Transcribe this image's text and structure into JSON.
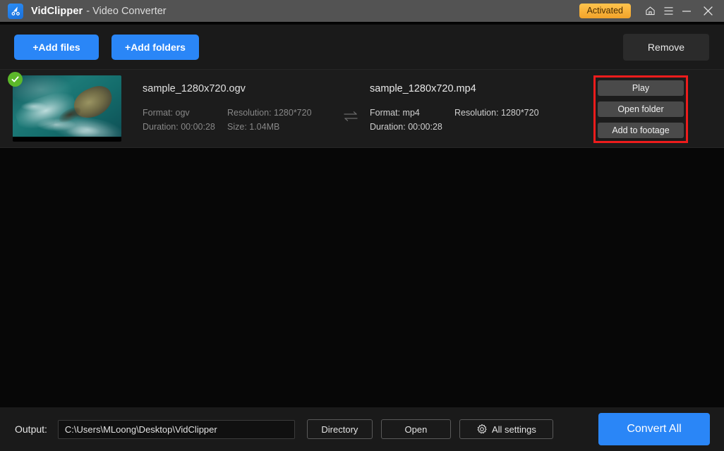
{
  "titlebar": {
    "app_name": "VidClipper",
    "subtitle": "- Video Converter",
    "app_icon": "vidclipper-logo-icon",
    "license_badge": "Activated",
    "badge_color": "#f2a32a",
    "home_icon": "home-icon",
    "menu_icon": "hamburger-menu-icon",
    "minimize_icon": "minimize-icon",
    "close_icon": "close-icon"
  },
  "toolbar": {
    "add_files": "+Add files",
    "add_folders": "+Add folders",
    "remove": "Remove",
    "accent_color": "#2a86f7"
  },
  "file_list": {
    "rows": [
      {
        "selected": true,
        "check_icon": "check-circle-icon",
        "thumbnail": "aerial-ocean-coastline-thumbnail",
        "source": {
          "filename": "sample_1280x720.ogv",
          "format_label": "Format: ogv",
          "resolution_label": "Resolution: 1280*720",
          "duration_label": "Duration: 00:00:28",
          "size_label": "Size: 1.04MB"
        },
        "swap_icon": "swap-arrows-icon",
        "target": {
          "filename": "sample_1280x720.mp4",
          "format_label": "Format: mp4",
          "resolution_label": "Resolution: 1280*720",
          "duration_label": "Duration: 00:00:28"
        },
        "actions": {
          "play": "Play",
          "open_folder": "Open folder",
          "add_to_footage": "Add to footage",
          "highlight_color": "#ee1c1c"
        }
      }
    ]
  },
  "bottombar": {
    "output_label": "Output:",
    "output_path": "C:\\Users\\MLoong\\Desktop\\VidClipper",
    "directory": "Directory",
    "open": "Open",
    "all_settings": "All settings",
    "settings_icon": "gear-icon",
    "convert_all": "Convert All"
  }
}
